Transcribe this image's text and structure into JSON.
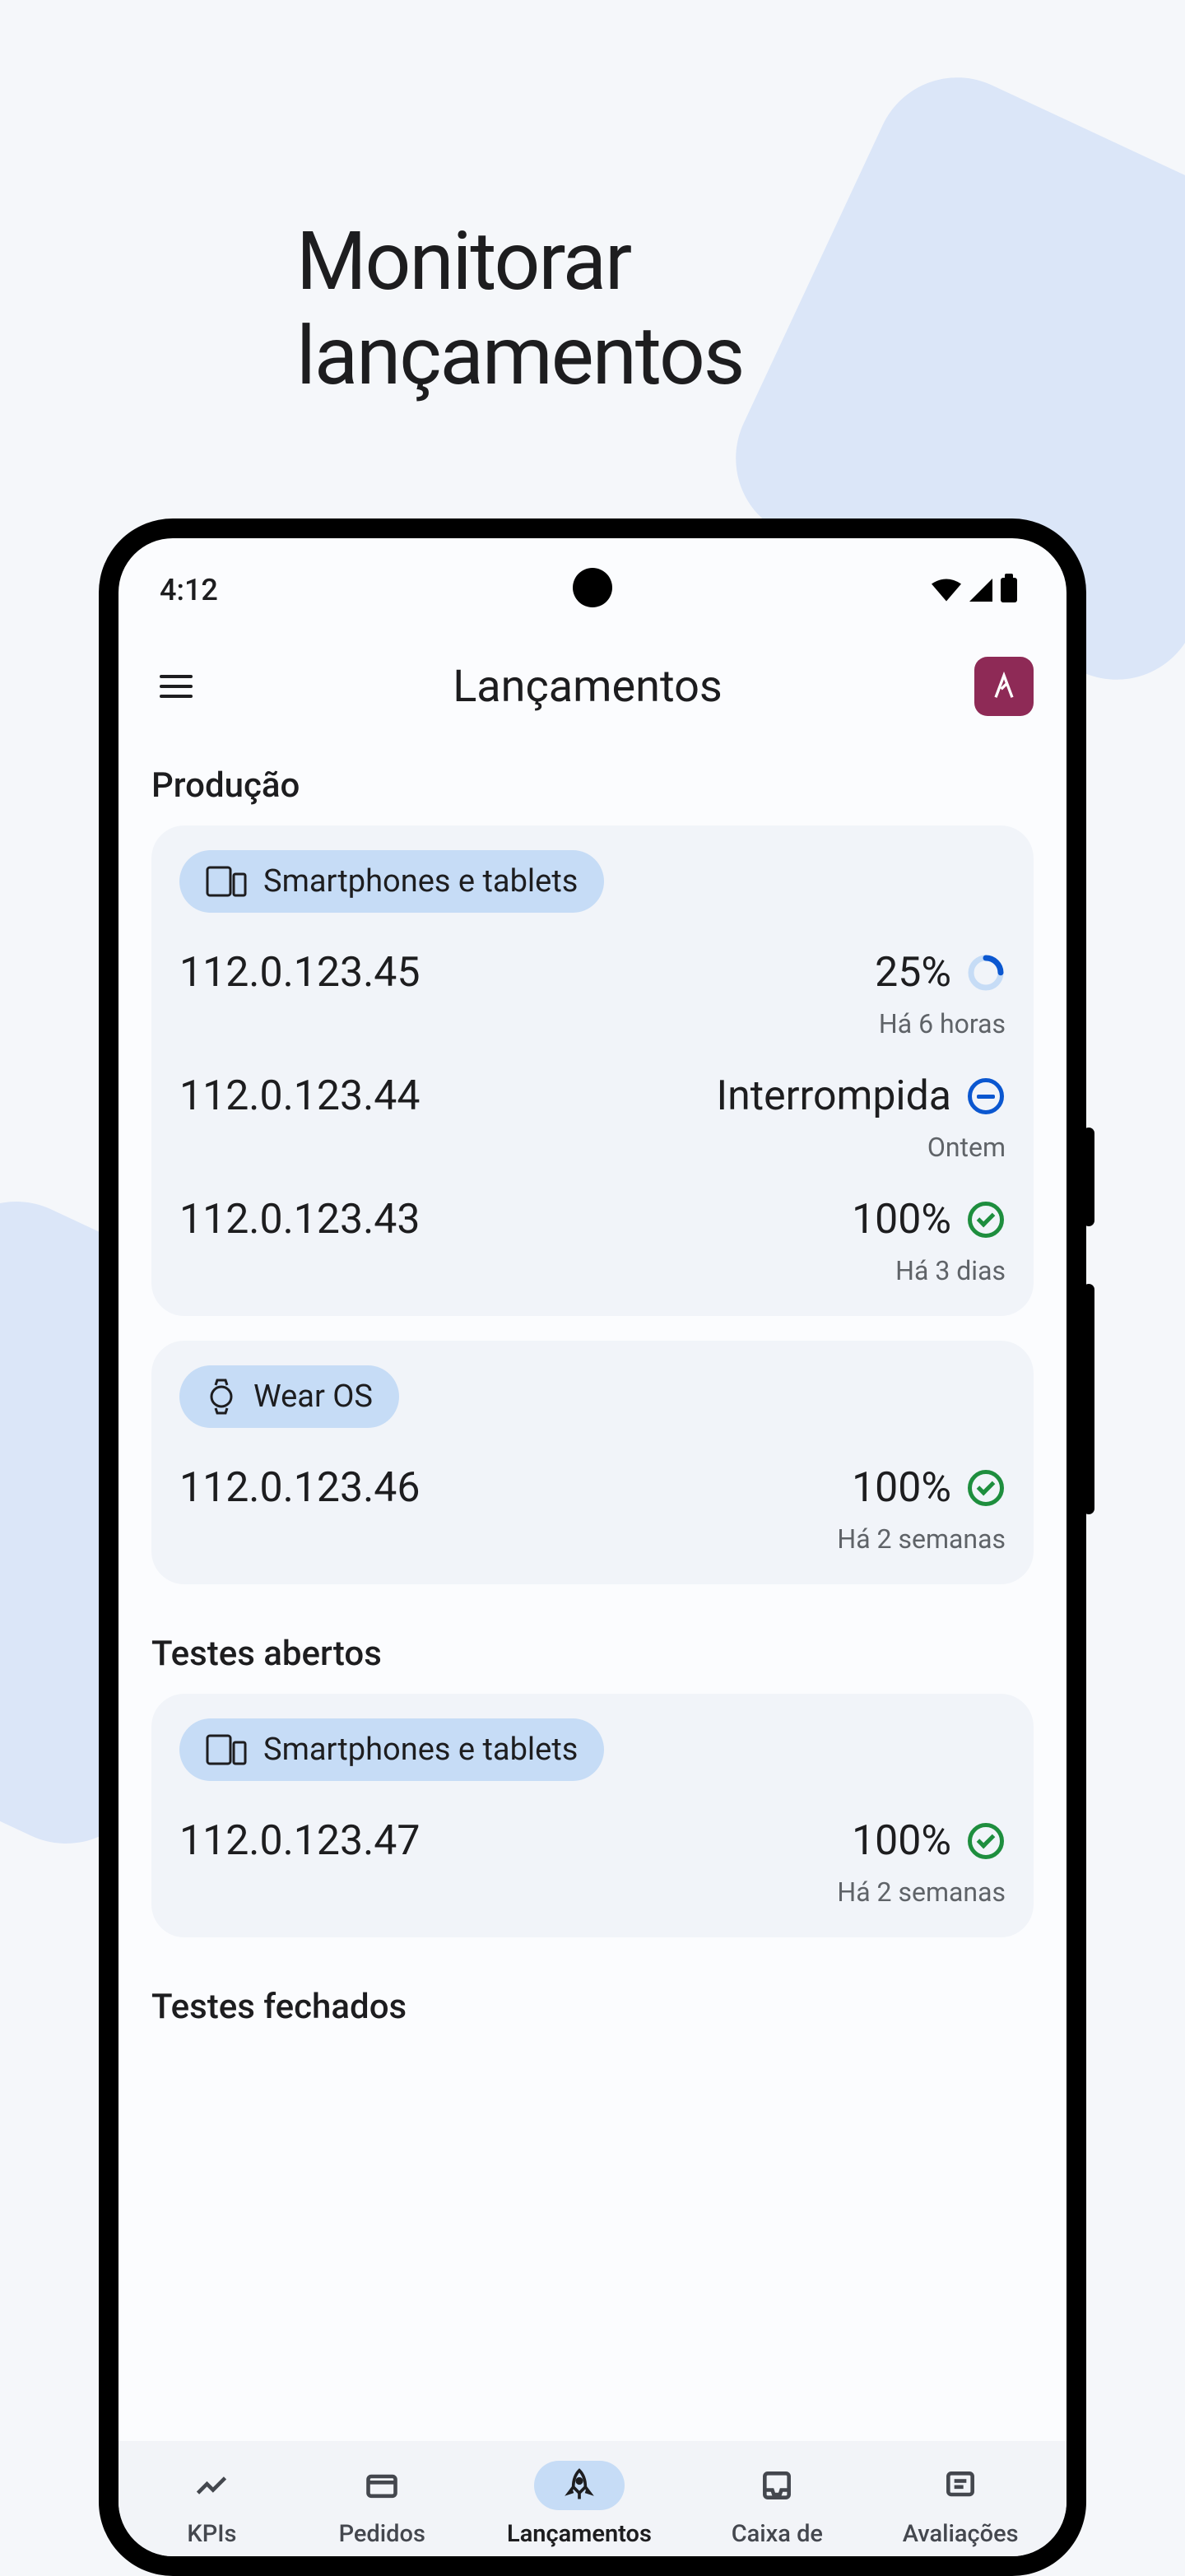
{
  "marketing_title": "Monitorar lançamentos",
  "status_bar": {
    "time": "4:12"
  },
  "app_bar": {
    "title": "Lançamentos"
  },
  "sections": [
    {
      "title": "Produção",
      "cards": [
        {
          "chip": {
            "icon": "devices",
            "label": "Smartphones e tablets"
          },
          "rows": [
            {
              "version": "112.0.123.45",
              "status": "25%",
              "status_icon": "progress",
              "time": "Há 6 horas"
            },
            {
              "version": "112.0.123.44",
              "status": "Interrompida",
              "status_icon": "halt",
              "time": "Ontem"
            },
            {
              "version": "112.0.123.43",
              "status": "100%",
              "status_icon": "check",
              "time": "Há 3 dias"
            }
          ]
        },
        {
          "chip": {
            "icon": "watch",
            "label": "Wear OS"
          },
          "rows": [
            {
              "version": "112.0.123.46",
              "status": "100%",
              "status_icon": "check",
              "time": "Há 2 semanas"
            }
          ]
        }
      ]
    },
    {
      "title": "Testes abertos",
      "cards": [
        {
          "chip": {
            "icon": "devices",
            "label": "Smartphones e tablets"
          },
          "rows": [
            {
              "version": "112.0.123.47",
              "status": "100%",
              "status_icon": "check",
              "time": "Há 2 semanas"
            }
          ]
        }
      ]
    },
    {
      "title": "Testes fechados",
      "cards": []
    }
  ],
  "nav": {
    "items": [
      {
        "label": "KPIs",
        "icon": "trend"
      },
      {
        "label": "Pedidos",
        "icon": "card"
      },
      {
        "label": "Lançamentos",
        "icon": "rocket",
        "active": true
      },
      {
        "label": "Caixa de",
        "icon": "inbox"
      },
      {
        "label": "Avaliações",
        "icon": "review"
      }
    ]
  }
}
